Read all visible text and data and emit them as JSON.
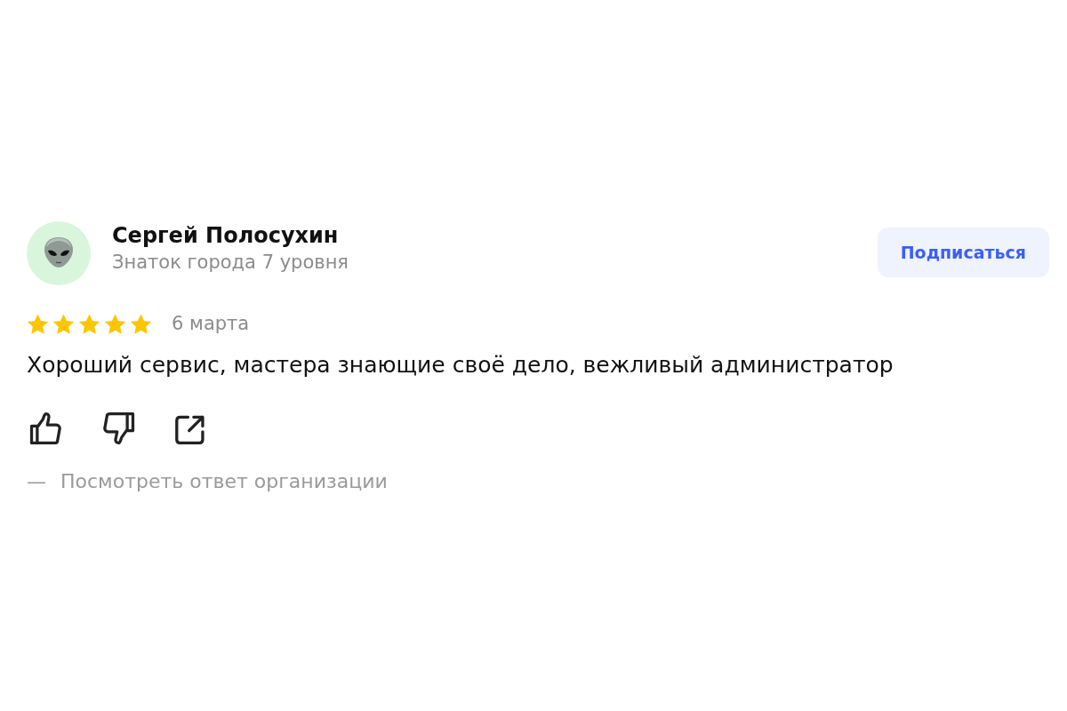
{
  "review": {
    "author": {
      "name": "Сергей Полосухин",
      "status": "Знаток города 7 уровня"
    },
    "subscribe_button": "Подписаться",
    "stars": 5,
    "date": "6 марта",
    "text": "Хороший сервис, мастера знающие своё дело, вежливый администратор",
    "response_link": {
      "dash": "—",
      "label": "Посмотреть ответ организации"
    }
  }
}
